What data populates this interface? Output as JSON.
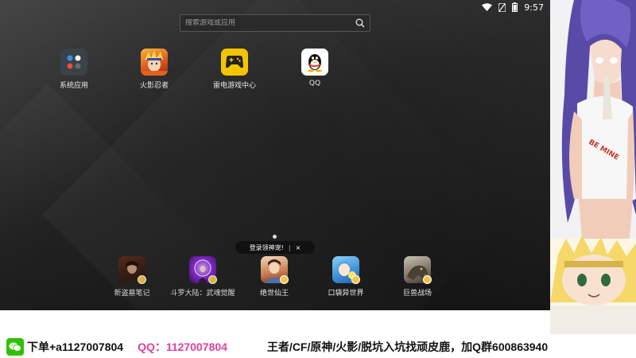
{
  "status_bar": {
    "time": "9:57"
  },
  "search": {
    "placeholder": "搜索游戏或应用"
  },
  "home_apps": [
    {
      "label": "系统应用",
      "icon": "system-apps-folder-icon"
    },
    {
      "label": "火影忍者",
      "icon": "naruto-game-icon"
    },
    {
      "label": "雷电游戏中心",
      "icon": "ldplayer-game-center-icon"
    },
    {
      "label": "QQ",
      "icon": "qq-penguin-icon"
    }
  ],
  "toast": {
    "text": "登录领神宠!",
    "close": "×",
    "divider": "|"
  },
  "dock_apps": [
    {
      "label": "新盗墓笔记",
      "icon": "tomb-notes-game-icon"
    },
    {
      "label": "斗罗大陆：武魂觉醒",
      "icon": "douluo-game-icon"
    },
    {
      "label": "绝世仙王",
      "icon": "immortal-king-game-icon"
    },
    {
      "label": "口袋异世界",
      "icon": "pocket-world-game-icon"
    },
    {
      "label": "巨兽战场",
      "icon": "beast-battlefield-game-icon"
    }
  ],
  "side_art": {
    "shirt_text": "BE MINE"
  },
  "banner": {
    "order_text": "下单+a1127007804",
    "qq_text": "QQ：1127007804",
    "promo_text": "王者/CF/原神/火影/脱坑入坑找顽皮鹿，加Q群600863940"
  },
  "colors": {
    "qq_text": "#e040a0",
    "wechat": "#2dc100",
    "ld_yellow": "#f5c400"
  }
}
